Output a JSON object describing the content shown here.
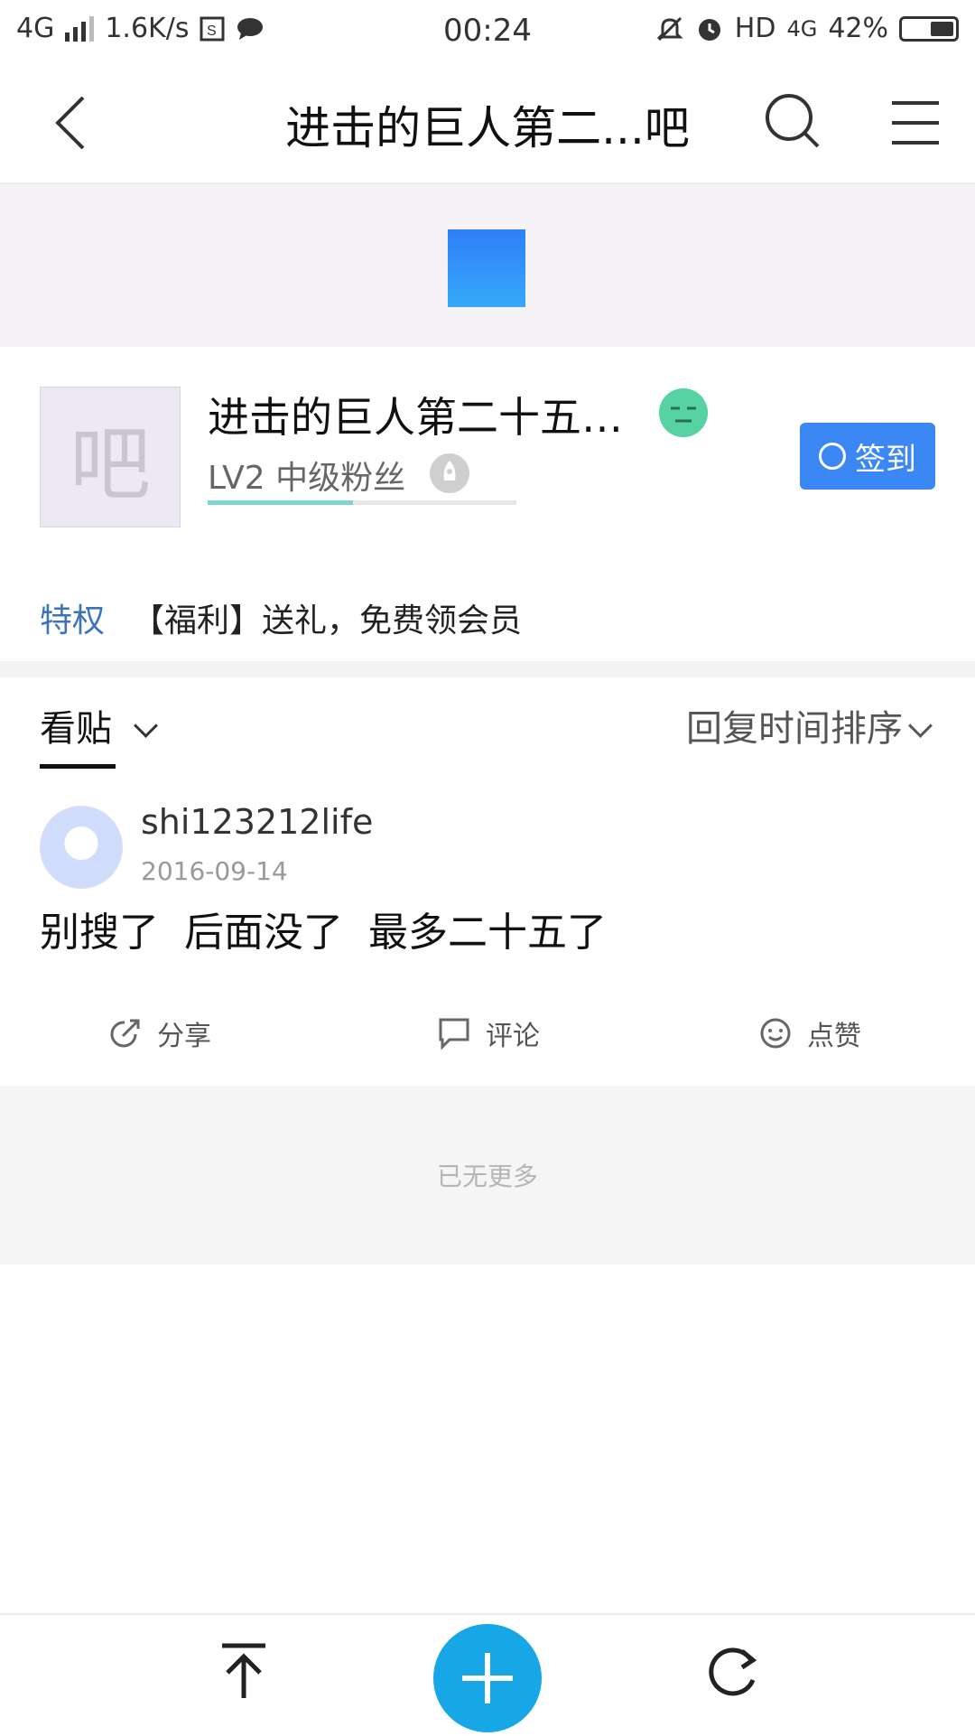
{
  "status_bar": {
    "network": "4G",
    "speed": "1.6K/s",
    "time": "00:24",
    "hd": "HD",
    "net_right": "4G",
    "battery": "42%"
  },
  "nav": {
    "title": "进击的巨人第二...吧"
  },
  "forum": {
    "avatar_char": "吧",
    "name": "进击的巨人第二十五…",
    "level": "LV2 中级粉丝",
    "level_progress": 0.47,
    "sign_label": "签到"
  },
  "privilege": {
    "label": "特权",
    "text": "【福利】送礼，免费领会员"
  },
  "tabs": {
    "view_posts": "看贴",
    "sort": "回复时间排序"
  },
  "post": {
    "username": "shi123212life",
    "date": "2016-09-14",
    "content": "别搜了  后面没了  最多二十五了",
    "actions": {
      "share": "分享",
      "comment": "评论",
      "like": "点赞"
    }
  },
  "footer": {
    "no_more": "已无更多"
  },
  "colors": {
    "accent": "#3b87f3",
    "fab": "#17a6e6",
    "privilege": "#3d74b8"
  }
}
